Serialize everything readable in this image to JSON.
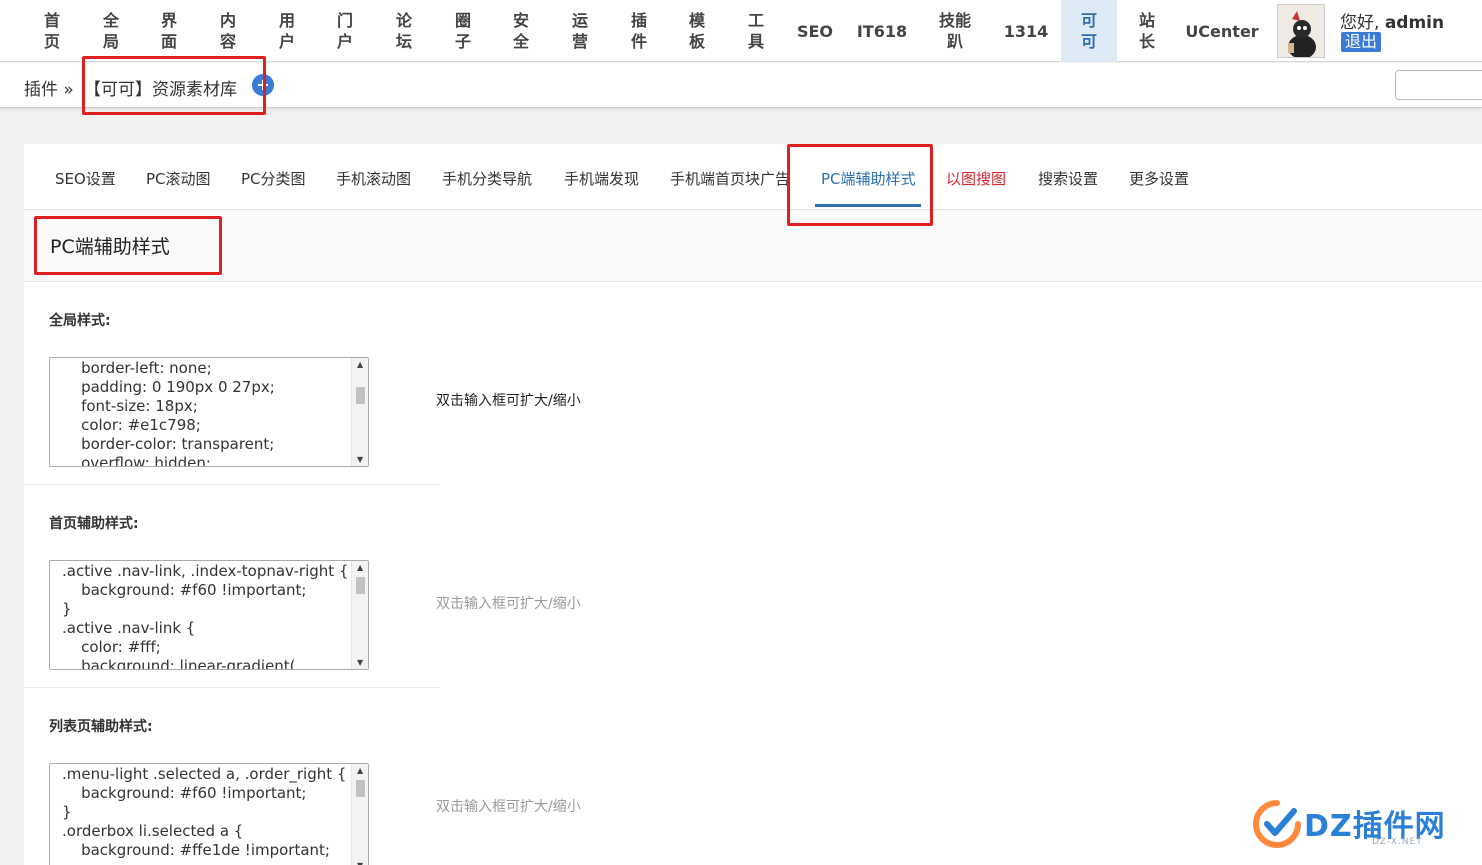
{
  "nav": {
    "items": [
      {
        "label": "首页"
      },
      {
        "label": "全局"
      },
      {
        "label": "界面"
      },
      {
        "label": "内容"
      },
      {
        "label": "用户"
      },
      {
        "label": "门户"
      },
      {
        "label": "论坛"
      },
      {
        "label": "圈子"
      },
      {
        "label": "安全"
      },
      {
        "label": "运营"
      },
      {
        "label": "插件"
      },
      {
        "label": "模板"
      },
      {
        "label": "工具"
      },
      {
        "label": "SEO"
      },
      {
        "label": "IT618"
      },
      {
        "label": "技能趴"
      },
      {
        "label": "1314"
      },
      {
        "label": "可可"
      },
      {
        "label": "站长"
      },
      {
        "label": "UCenter"
      }
    ],
    "active_index": 17,
    "greeting": "您好,",
    "username": "admin",
    "logout": "退出"
  },
  "breadcrumb": {
    "plugins": "插件 »",
    "current": "【可可】资源素材库",
    "add_icon": "+"
  },
  "tabs": [
    {
      "label": "SEO设置"
    },
    {
      "label": "PC滚动图"
    },
    {
      "label": "PC分类图"
    },
    {
      "label": "手机滚动图"
    },
    {
      "label": "手机分类导航"
    },
    {
      "label": "手机端发现"
    },
    {
      "label": "手机端首页块广告"
    },
    {
      "label": "PC端辅助样式",
      "active": true
    },
    {
      "label": "以图搜图",
      "highlight": "red"
    },
    {
      "label": "搜索设置"
    },
    {
      "label": "更多设置"
    }
  ],
  "section": {
    "title": "PC端辅助样式"
  },
  "fields": [
    {
      "label": "全局样式:",
      "code": "    border-left: none;\n    padding: 0 190px 0 27px;\n    font-size: 18px;\n    color: #e1c798;\n    border-color: transparent;\n    overflow: hidden;",
      "hint": "双击输入框可扩大/缩小"
    },
    {
      "label": "首页辅助样式:",
      "code": ".active .nav-link, .index-topnav-right {\n    background: #f60 !important;\n}\n.active .nav-link {\n    color: #fff;\n    background: linear-gradient(",
      "hint": "双击输入框可扩大/缩小"
    },
    {
      "label": "列表页辅助样式:",
      "code": ".menu-light .selected a, .order_right {\n    background: #f60 !important;\n}\n.orderbox li.selected a {\n    background: #ffe1de !important;",
      "hint": "双击输入框可扩大/缩小"
    }
  ],
  "watermark": {
    "text": "DZ插件网",
    "sub": "DZ-X.NET"
  },
  "colors": {
    "accent": "#2c6fb3",
    "annotation": "#e02020",
    "tab_red": "#d9262b"
  }
}
